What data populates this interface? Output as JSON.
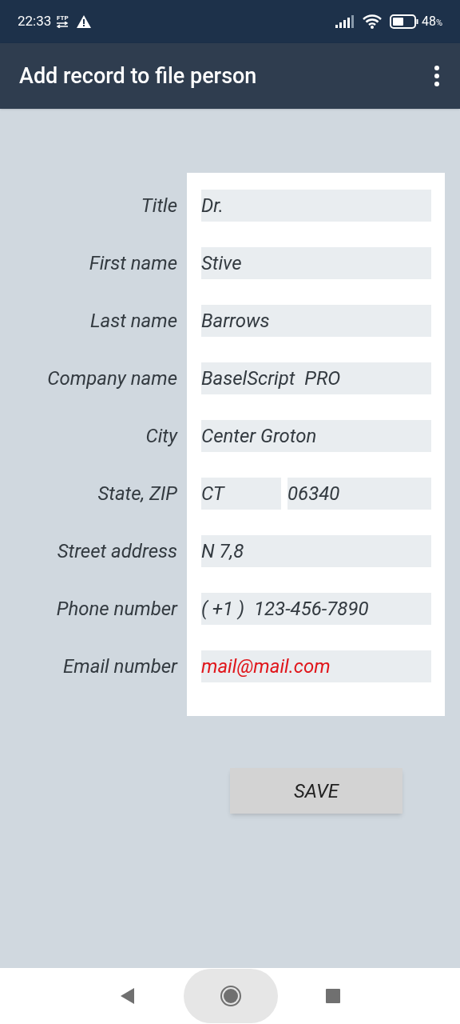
{
  "status_bar": {
    "time": "22:33",
    "ftp_label": "FTP",
    "battery": "48",
    "battery_unit": "%"
  },
  "app_bar": {
    "title": "Add record to file person"
  },
  "form": {
    "rows": [
      {
        "label": "Title",
        "kind": "text",
        "values": [
          "Dr."
        ]
      },
      {
        "label": "First name",
        "kind": "text",
        "values": [
          "Stive"
        ]
      },
      {
        "label": "Last name",
        "kind": "text",
        "values": [
          "Barrows"
        ]
      },
      {
        "label": "Company name",
        "kind": "text",
        "values": [
          "BaselScript  PRO"
        ]
      },
      {
        "label": "City",
        "kind": "text",
        "values": [
          "Center Groton"
        ]
      },
      {
        "label": "State, ZIP",
        "kind": "text",
        "values": [
          "CT",
          "06340"
        ]
      },
      {
        "label": "Street address",
        "kind": "text",
        "values": [
          "N 7,8"
        ]
      },
      {
        "label": "Phone number",
        "kind": "text",
        "values": [
          "( +1 )  123-456-7890"
        ]
      },
      {
        "label": "Email number",
        "kind": "email",
        "values": [
          "mail@mail.com"
        ]
      }
    ]
  },
  "save_button": "SAVE"
}
